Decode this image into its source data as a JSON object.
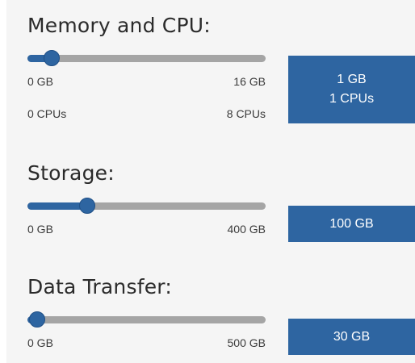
{
  "memory_cpu": {
    "title": "Memory and CPU:",
    "memory_min": "0 GB",
    "memory_max": "16 GB",
    "cpu_min": "0 CPUs",
    "cpu_max": "8 CPUs",
    "memory_value": "1 GB",
    "cpu_value": "1 CPUs",
    "slider_level": 0.1
  },
  "storage": {
    "title": "Storage:",
    "min": "0 GB",
    "max": "400 GB",
    "value": "100 GB",
    "slider_level": 0.25
  },
  "data_transfer": {
    "title": "Data Transfer:",
    "min": "0 GB",
    "max": "500 GB",
    "value": "30 GB",
    "slider_level": 0.02
  },
  "colors": {
    "accent": "#2e65a1",
    "track": "#a5a5a5",
    "panel_bg": "#f5f5f5"
  }
}
